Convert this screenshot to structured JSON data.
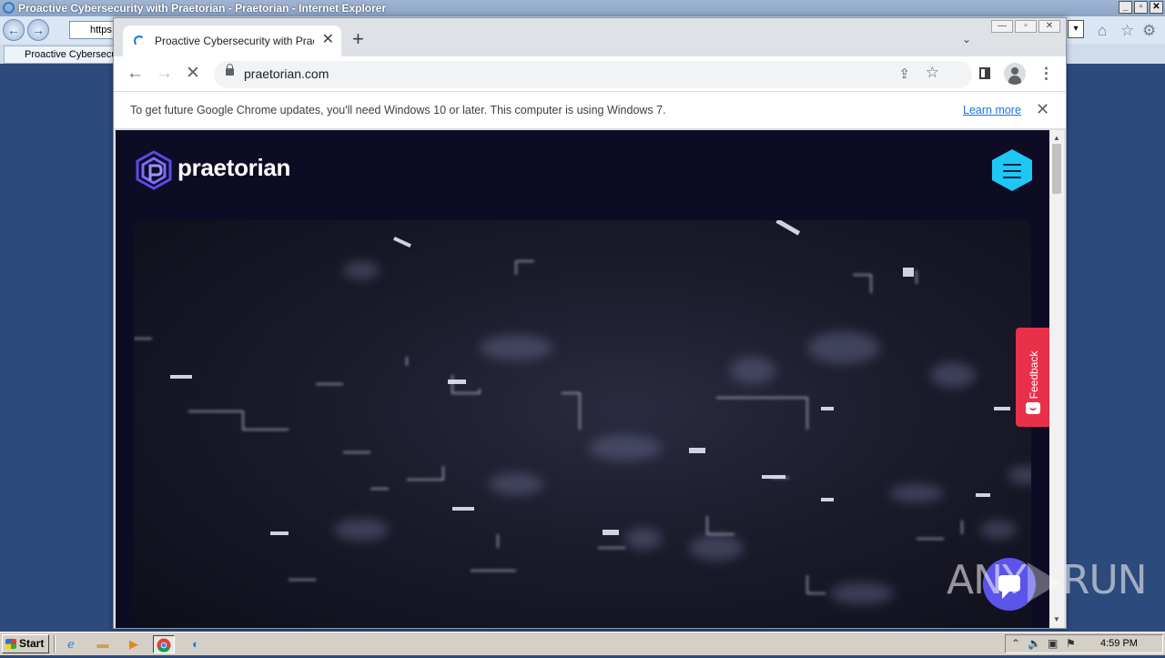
{
  "ie": {
    "title": "Proactive Cybersecurity with Praetorian - Praetorian - Internet Explorer",
    "address_value": "https",
    "tab_label": "Proactive Cybersecu",
    "window_buttons": [
      "_",
      "▫",
      "✕"
    ]
  },
  "chrome": {
    "tab_title": "Proactive Cybersecurity with Praetorian",
    "tab_close": "✕",
    "new_tab": "+",
    "tab_search": "⌄",
    "window_buttons": [
      "—",
      "▫",
      "✕"
    ],
    "url": "praetorian.com",
    "back": "←",
    "forward": "→",
    "stop": "✕",
    "share_icon": "⇪",
    "star_icon": "☆",
    "menu_icon": "⋮"
  },
  "infobar": {
    "message": "To get future Google Chrome updates, you'll need Windows 10 or later. This computer is using Windows 7.",
    "learn_more": "Learn more",
    "close": "✕"
  },
  "site": {
    "brand": "praetorian",
    "accent": "#1fc7f5",
    "background": "#0d0c24",
    "feedback_label": "Feedback"
  },
  "watermark": {
    "left": "ANY",
    "right": "RUN"
  },
  "taskbar": {
    "start": "Start",
    "clock": "4:59 PM"
  }
}
